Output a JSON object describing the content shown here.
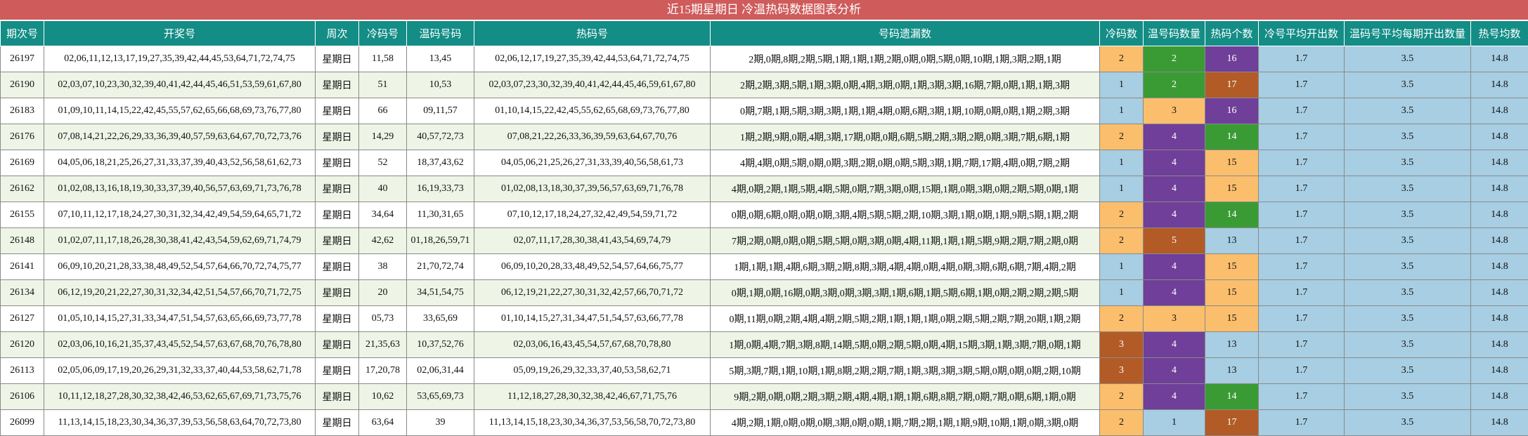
{
  "title": "近15期星期日 冷温热码数据图表分析",
  "headers": [
    "期次号",
    "开奖号",
    "周次",
    "冷码号",
    "温码号码",
    "热码号",
    "号码遗漏数",
    "冷码数",
    "温号码数量",
    "热码个数",
    "冷号平均开出数",
    "温码号平均每期开出数量",
    "热号均数"
  ],
  "colors": {
    "title_bg": "#cf5b5b",
    "header_bg": "#138d85",
    "row_odd": "#ffffff",
    "row_even": "#eef5e6",
    "light": "#a7cee2",
    "orange": "#fbbe6c",
    "green": "#3a9b35",
    "purple": "#6f3f99",
    "brown": "#b25b27"
  },
  "rows": [
    {
      "period": "26197",
      "draw": "02,06,11,12,13,17,19,27,35,39,42,44,45,53,64,71,72,74,75",
      "weekday": "星期日",
      "cold": "11,58",
      "warm": "13,45",
      "hot": "02,06,12,17,19,27,35,39,42,44,53,64,71,72,74,75",
      "omission": "2期,0期,8期,2期,5期,1期,1期,1期,2期,0期,0期,5期,0期,10期,1期,3期,2期,1期",
      "cold_count": "2",
      "cold_color": "orange",
      "warm_count": "2",
      "warm_color": "green",
      "hot_count": "16",
      "hot_color": "purple",
      "cold_avg": "1.7",
      "warm_avg": "3.5",
      "hot_avg": "14.8"
    },
    {
      "period": "26190",
      "draw": "02,03,07,10,23,30,32,39,40,41,42,44,45,46,51,53,59,61,67,80",
      "weekday": "星期日",
      "cold": "51",
      "warm": "10,53",
      "hot": "02,03,07,23,30,32,39,40,41,42,44,45,46,59,61,67,80",
      "omission": "2期,2期,3期,5期,1期,3期,0期,4期,3期,0期,1期,3期,3期,16期,7期,0期,1期,1期,3期",
      "cold_count": "1",
      "cold_color": "light",
      "warm_count": "2",
      "warm_color": "green",
      "hot_count": "17",
      "hot_color": "brown",
      "cold_avg": "1.7",
      "warm_avg": "3.5",
      "hot_avg": "14.8"
    },
    {
      "period": "26183",
      "draw": "01,09,10,11,14,15,22,42,45,55,57,62,65,66,68,69,73,76,77,80",
      "weekday": "星期日",
      "cold": "66",
      "warm": "09,11,57",
      "hot": "01,10,14,15,22,42,45,55,62,65,68,69,73,76,77,80",
      "omission": "0期,7期,1期,5期,3期,3期,1期,1期,4期,0期,6期,3期,1期,10期,0期,0期,1期,2期,3期",
      "cold_count": "1",
      "cold_color": "light",
      "warm_count": "3",
      "warm_color": "orange",
      "hot_count": "16",
      "hot_color": "purple",
      "cold_avg": "1.7",
      "warm_avg": "3.5",
      "hot_avg": "14.8"
    },
    {
      "period": "26176",
      "draw": "07,08,14,21,22,26,29,33,36,39,40,57,59,63,64,67,70,72,73,76",
      "weekday": "星期日",
      "cold": "14,29",
      "warm": "40,57,72,73",
      "hot": "07,08,21,22,26,33,36,39,59,63,64,67,70,76",
      "omission": "1期,2期,9期,0期,4期,3期,17期,0期,0期,6期,5期,2期,3期,2期,0期,3期,7期,6期,1期",
      "cold_count": "2",
      "cold_color": "orange",
      "warm_count": "4",
      "warm_color": "purple",
      "hot_count": "14",
      "hot_color": "green",
      "cold_avg": "1.7",
      "warm_avg": "3.5",
      "hot_avg": "14.8"
    },
    {
      "period": "26169",
      "draw": "04,05,06,18,21,25,26,27,31,33,37,39,40,43,52,56,58,61,62,73",
      "weekday": "星期日",
      "cold": "52",
      "warm": "18,37,43,62",
      "hot": "04,05,06,21,25,26,27,31,33,39,40,56,58,61,73",
      "omission": "4期,4期,0期,5期,0期,0期,3期,2期,0期,0期,5期,3期,1期,7期,17期,4期,0期,7期,2期",
      "cold_count": "1",
      "cold_color": "light",
      "warm_count": "4",
      "warm_color": "purple",
      "hot_count": "15",
      "hot_color": "orange",
      "cold_avg": "1.7",
      "warm_avg": "3.5",
      "hot_avg": "14.8"
    },
    {
      "period": "26162",
      "draw": "01,02,08,13,16,18,19,30,33,37,39,40,56,57,63,69,71,73,76,78",
      "weekday": "星期日",
      "cold": "40",
      "warm": "16,19,33,73",
      "hot": "01,02,08,13,18,30,37,39,56,57,63,69,71,76,78",
      "omission": "4期,0期,2期,1期,5期,4期,5期,0期,7期,3期,0期,15期,1期,0期,3期,0期,2期,5期,0期,1期",
      "cold_count": "1",
      "cold_color": "light",
      "warm_count": "4",
      "warm_color": "purple",
      "hot_count": "15",
      "hot_color": "orange",
      "cold_avg": "1.7",
      "warm_avg": "3.5",
      "hot_avg": "14.8"
    },
    {
      "period": "26155",
      "draw": "07,10,11,12,17,18,24,27,30,31,32,34,42,49,54,59,64,65,71,72",
      "weekday": "星期日",
      "cold": "34,64",
      "warm": "11,30,31,65",
      "hot": "07,10,12,17,18,24,27,32,42,49,54,59,71,72",
      "omission": "0期,0期,6期,0期,0期,0期,3期,4期,5期,5期,2期,10期,3期,1期,0期,1期,9期,5期,1期,2期",
      "cold_count": "2",
      "cold_color": "orange",
      "warm_count": "4",
      "warm_color": "purple",
      "hot_count": "14",
      "hot_color": "green",
      "cold_avg": "1.7",
      "warm_avg": "3.5",
      "hot_avg": "14.8"
    },
    {
      "period": "26148",
      "draw": "01,02,07,11,17,18,26,28,30,38,41,42,43,54,59,62,69,71,74,79",
      "weekday": "星期日",
      "cold": "42,62",
      "warm": "01,18,26,59,71",
      "hot": "02,07,11,17,28,30,38,41,43,54,69,74,79",
      "omission": "7期,2期,0期,0期,0期,5期,5期,0期,3期,0期,4期,11期,1期,1期,5期,9期,2期,7期,2期,0期",
      "cold_count": "2",
      "cold_color": "orange",
      "warm_count": "5",
      "warm_color": "brown",
      "hot_count": "13",
      "hot_color": "light",
      "cold_avg": "1.7",
      "warm_avg": "3.5",
      "hot_avg": "14.8"
    },
    {
      "period": "26141",
      "draw": "06,09,10,20,21,28,33,38,48,49,52,54,57,64,66,70,72,74,75,77",
      "weekday": "星期日",
      "cold": "38",
      "warm": "21,70,72,74",
      "hot": "06,09,10,20,28,33,48,49,52,54,57,64,66,75,77",
      "omission": "1期,1期,1期,4期,6期,3期,2期,8期,3期,4期,4期,0期,4期,0期,3期,6期,6期,7期,4期,2期",
      "cold_count": "1",
      "cold_color": "light",
      "warm_count": "4",
      "warm_color": "purple",
      "hot_count": "15",
      "hot_color": "orange",
      "cold_avg": "1.7",
      "warm_avg": "3.5",
      "hot_avg": "14.8"
    },
    {
      "period": "26134",
      "draw": "06,12,19,20,21,22,27,30,31,32,34,42,51,54,57,66,70,71,72,75",
      "weekday": "星期日",
      "cold": "20",
      "warm": "34,51,54,75",
      "hot": "06,12,19,21,22,27,30,31,32,42,57,66,70,71,72",
      "omission": "0期,1期,0期,16期,0期,3期,0期,3期,3期,1期,6期,1期,5期,6期,1期,0期,2期,2期,2期,5期",
      "cold_count": "1",
      "cold_color": "light",
      "warm_count": "4",
      "warm_color": "purple",
      "hot_count": "15",
      "hot_color": "orange",
      "cold_avg": "1.7",
      "warm_avg": "3.5",
      "hot_avg": "14.8"
    },
    {
      "period": "26127",
      "draw": "01,05,10,14,15,27,31,33,34,47,51,54,57,63,65,66,69,73,77,78",
      "weekday": "星期日",
      "cold": "05,73",
      "warm": "33,65,69",
      "hot": "01,10,14,15,27,31,34,47,51,54,57,63,66,77,78",
      "omission": "0期,11期,0期,2期,4期,4期,2期,5期,2期,1期,1期,1期,0期,2期,5期,2期,7期,20期,1期,2期",
      "cold_count": "2",
      "cold_color": "orange",
      "warm_count": "3",
      "warm_color": "orange",
      "hot_count": "15",
      "hot_color": "orange",
      "cold_avg": "1.7",
      "warm_avg": "3.5",
      "hot_avg": "14.8"
    },
    {
      "period": "26120",
      "draw": "02,03,06,10,16,21,35,37,43,45,52,54,57,63,67,68,70,76,78,80",
      "weekday": "星期日",
      "cold": "21,35,63",
      "warm": "10,37,52,76",
      "hot": "02,03,06,16,43,45,54,57,67,68,70,78,80",
      "omission": "1期,0期,4期,7期,3期,8期,14期,5期,0期,2期,5期,0期,4期,15期,3期,1期,3期,7期,0期,1期",
      "cold_count": "3",
      "cold_color": "brown",
      "warm_count": "4",
      "warm_color": "purple",
      "hot_count": "13",
      "hot_color": "light",
      "cold_avg": "1.7",
      "warm_avg": "3.5",
      "hot_avg": "14.8"
    },
    {
      "period": "26113",
      "draw": "02,05,06,09,17,19,20,26,29,31,32,33,37,40,44,53,58,62,71,78",
      "weekday": "星期日",
      "cold": "17,20,78",
      "warm": "02,06,31,44",
      "hot": "05,09,19,26,29,32,33,37,40,53,58,62,71",
      "omission": "5期,3期,7期,1期,10期,1期,8期,2期,2期,7期,1期,3期,3期,3期,5期,0期,0期,0期,2期,10期",
      "cold_count": "3",
      "cold_color": "brown",
      "warm_count": "4",
      "warm_color": "purple",
      "hot_count": "13",
      "hot_color": "light",
      "cold_avg": "1.7",
      "warm_avg": "3.5",
      "hot_avg": "14.8"
    },
    {
      "period": "26106",
      "draw": "10,11,12,18,27,28,30,32,38,42,46,53,62,65,67,69,71,73,75,76",
      "weekday": "星期日",
      "cold": "10,62",
      "warm": "53,65,69,73",
      "hot": "11,12,18,27,28,30,32,38,42,46,67,71,75,76",
      "omission": "9期,2期,0期,0期,2期,3期,2期,4期,4期,1期,1期,6期,8期,7期,0期,7期,0期,6期,1期,0期",
      "cold_count": "2",
      "cold_color": "orange",
      "warm_count": "4",
      "warm_color": "purple",
      "hot_count": "14",
      "hot_color": "green",
      "cold_avg": "1.7",
      "warm_avg": "3.5",
      "hot_avg": "14.8"
    },
    {
      "period": "26099",
      "draw": "11,13,14,15,18,23,30,34,36,37,39,53,56,58,63,64,70,72,73,80",
      "weekday": "星期日",
      "cold": "63,64",
      "warm": "39",
      "hot": "11,13,14,15,18,23,30,34,36,37,53,56,58,70,72,73,80",
      "omission": "4期,2期,1期,0期,0期,0期,3期,0期,0期,1期,7期,2期,1期,1期,9期,10期,1期,0期,3期,0期",
      "cold_count": "2",
      "cold_color": "orange",
      "warm_count": "1",
      "warm_color": "light",
      "hot_count": "17",
      "hot_color": "brown",
      "cold_avg": "1.7",
      "warm_avg": "3.5",
      "hot_avg": "14.8"
    }
  ]
}
